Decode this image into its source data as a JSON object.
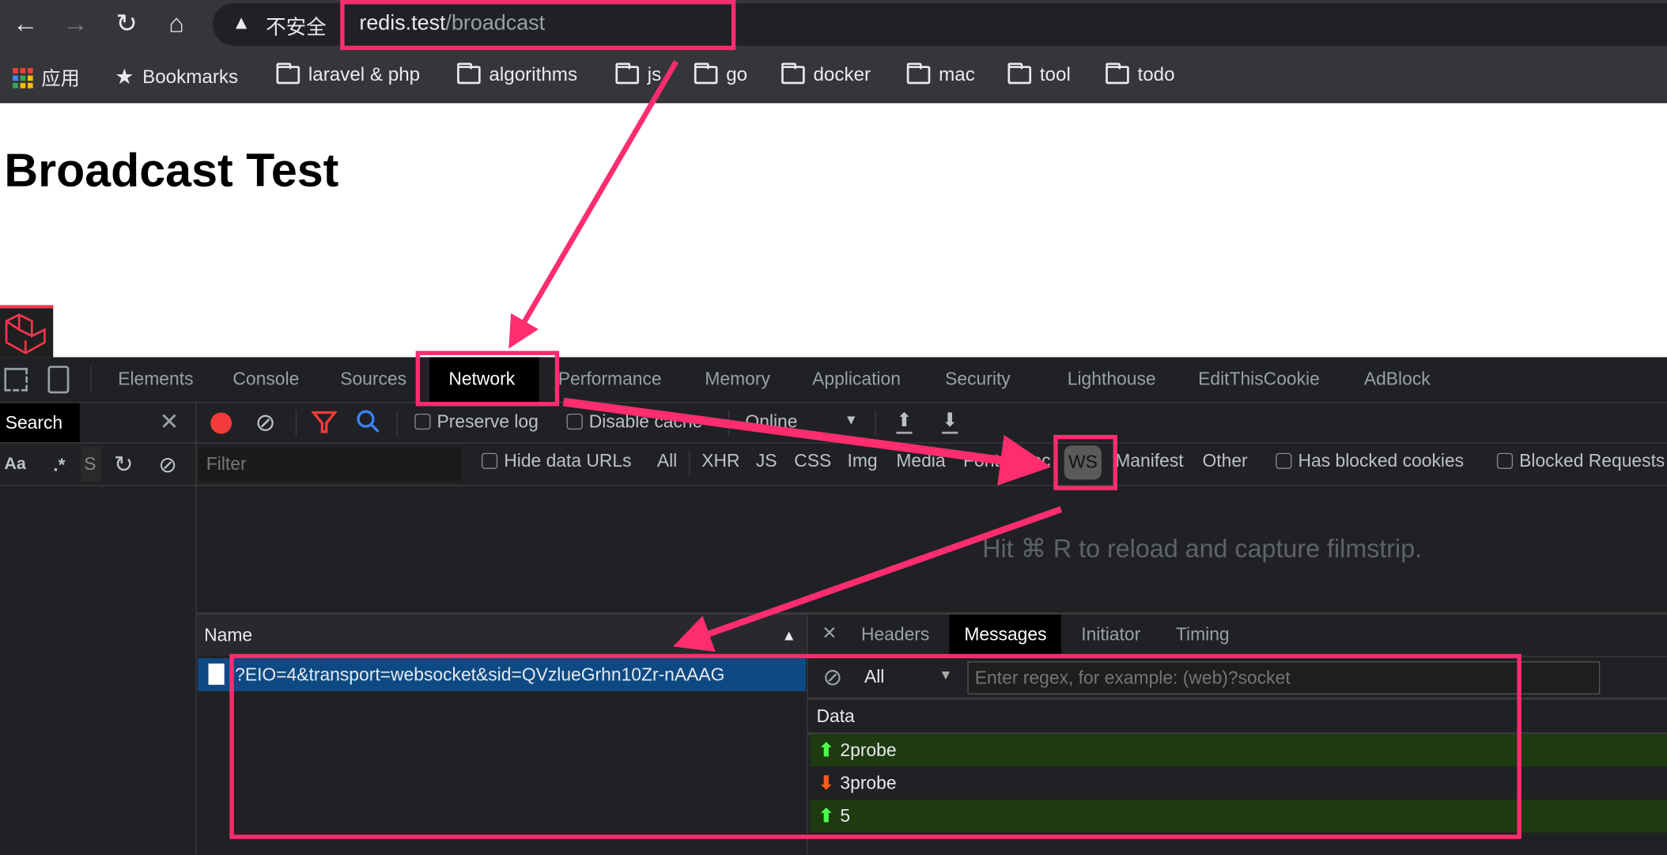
{
  "browser": {
    "security_label": "不安全",
    "url_host": "redis.test",
    "url_path": "/broadcast",
    "bookmarks": [
      "应用",
      "Bookmarks",
      "laravel & php",
      "algorithms",
      "js",
      "go",
      "docker",
      "mac",
      "tool",
      "todo"
    ]
  },
  "page": {
    "title": "Broadcast Test"
  },
  "devtools": {
    "tabs": [
      "Elements",
      "Console",
      "Sources",
      "Network",
      "Performance",
      "Memory",
      "Application",
      "Security",
      "Lighthouse",
      "EditThisCookie",
      "AdBlock"
    ],
    "active_tab": "Network",
    "search_panel": {
      "title": "Search",
      "aa": "Aa",
      "regex": ".*",
      "input_placeholder": "S"
    },
    "toolbar": {
      "preserve_log": "Preserve log",
      "disable_cache": "Disable cache",
      "throttling": "Online"
    },
    "filter": {
      "placeholder": "Filter",
      "hide_data_urls": "Hide data URLs",
      "types": [
        "All",
        "XHR",
        "JS",
        "CSS",
        "Img",
        "Media",
        "Font",
        "Doc",
        "WS",
        "Manifest",
        "Other"
      ],
      "active_type": "WS",
      "has_blocked_cookies": "Has blocked cookies",
      "blocked_requests": "Blocked Requests"
    },
    "filmstrip_hint": "Hit ⌘ R to reload and capture filmstrip.",
    "requests": {
      "column": "Name",
      "rows": [
        "?EIO=4&transport=websocket&sid=QVzlueGrhn10Zr-nAAAG"
      ]
    },
    "detail": {
      "tabs": [
        "Headers",
        "Messages",
        "Initiator",
        "Timing"
      ],
      "active_tab": "Messages",
      "message_filter": "All",
      "regex_placeholder": "Enter regex, for example: (web)?socket",
      "data_header": "Data",
      "messages": [
        {
          "direction": "sent",
          "data": "2probe"
        },
        {
          "direction": "received",
          "data": "3probe"
        },
        {
          "direction": "sent",
          "data": "5"
        }
      ]
    }
  },
  "colors": {
    "annotation": "#ff2d6f",
    "sent_row": "#1d3a10",
    "sent_arrow": "#4cff4c",
    "received_arrow": "#ff5a1f",
    "selected_row": "#0d4a84",
    "record": "#f43b3b"
  }
}
